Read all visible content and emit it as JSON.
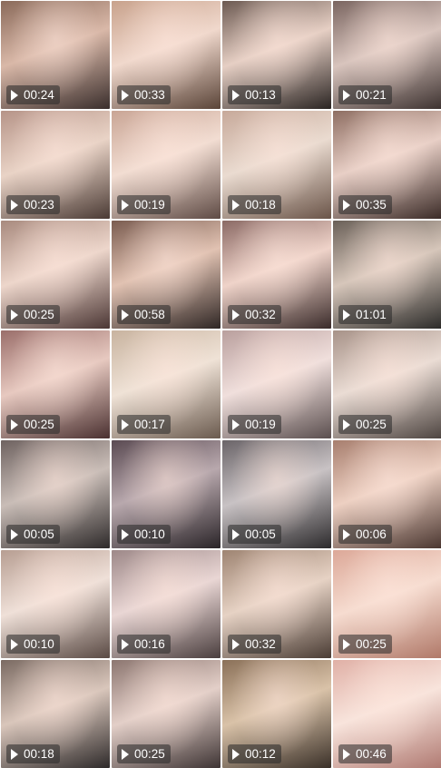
{
  "videos": [
    {
      "duration": "00:24",
      "colors": [
        "#3a2e2c",
        "#8a6a5a",
        "#d9b8a8"
      ]
    },
    {
      "duration": "00:33",
      "colors": [
        "#5a4438",
        "#c8a28c",
        "#f0d8cc"
      ]
    },
    {
      "duration": "00:13",
      "colors": [
        "#2a2422",
        "#6c5a52",
        "#e6cfc4"
      ]
    },
    {
      "duration": "00:21",
      "colors": [
        "#3d3230",
        "#7a6560",
        "#d8c4bd"
      ]
    },
    {
      "duration": "00:23",
      "colors": [
        "#4a3a34",
        "#b69488",
        "#e9d3c6"
      ]
    },
    {
      "duration": "00:19",
      "colors": [
        "#5e4a44",
        "#c9a595",
        "#f2ddd2"
      ]
    },
    {
      "duration": "00:18",
      "colors": [
        "#6a5448",
        "#c7a99a",
        "#eadbd0"
      ]
    },
    {
      "duration": "00:35",
      "colors": [
        "#3a2a26",
        "#8e6e62",
        "#e8cfc6"
      ]
    },
    {
      "duration": "00:25",
      "colors": [
        "#4b3634",
        "#a88a7e",
        "#edd6cb"
      ]
    },
    {
      "duration": "00:58",
      "colors": [
        "#2f2624",
        "#7a5c50",
        "#e1c2b2"
      ]
    },
    {
      "duration": "00:32",
      "colors": [
        "#3a2b2a",
        "#8b6a65",
        "#efd3c9"
      ]
    },
    {
      "duration": "01:01",
      "colors": [
        "#2b2a28",
        "#6a6058",
        "#d6c6ba"
      ]
    },
    {
      "duration": "00:25",
      "colors": [
        "#4a3030",
        "#9a6e6a",
        "#e7c9c0"
      ]
    },
    {
      "duration": "00:17",
      "colors": [
        "#6a5a4e",
        "#c8b39f",
        "#efe2d6"
      ]
    },
    {
      "duration": "00:19",
      "colors": [
        "#5a4e4e",
        "#b99f9d",
        "#f0dfdc"
      ]
    },
    {
      "duration": "00:25",
      "colors": [
        "#4d4440",
        "#a79288",
        "#eadcd4"
      ]
    },
    {
      "duration": "00:05",
      "colors": [
        "#2e2a2a",
        "#6e6260",
        "#c9bdb7"
      ]
    },
    {
      "duration": "00:10",
      "colors": [
        "#2a2428",
        "#5a4a52",
        "#b8a8ad"
      ]
    },
    {
      "duration": "00:05",
      "colors": [
        "#2c2a2c",
        "#6a6468",
        "#c8c2c4"
      ]
    },
    {
      "duration": "00:06",
      "colors": [
        "#4a3630",
        "#a77e6e",
        "#edd0c2"
      ]
    },
    {
      "duration": "00:10",
      "colors": [
        "#5a4a44",
        "#b79e92",
        "#efe0d8"
      ]
    },
    {
      "duration": "00:16",
      "colors": [
        "#4a3e3e",
        "#9d8888",
        "#e9d6d4"
      ]
    },
    {
      "duration": "00:32",
      "colors": [
        "#4a3c34",
        "#9e8472",
        "#e6d2c4"
      ]
    },
    {
      "duration": "00:25",
      "colors": [
        "#b07868",
        "#dca898",
        "#f6dcd0"
      ]
    },
    {
      "duration": "00:18",
      "colors": [
        "#2e2a2a",
        "#7a6a62",
        "#d9c6bb"
      ]
    },
    {
      "duration": "00:25",
      "colors": [
        "#3e3434",
        "#8c7670",
        "#e3cfc8"
      ]
    },
    {
      "duration": "00:12",
      "colors": [
        "#3a3028",
        "#8a7058",
        "#d9c2a8"
      ]
    },
    {
      "duration": "00:46",
      "colors": [
        "#b07a72",
        "#e0b0a6",
        "#f8e4dc"
      ]
    }
  ]
}
